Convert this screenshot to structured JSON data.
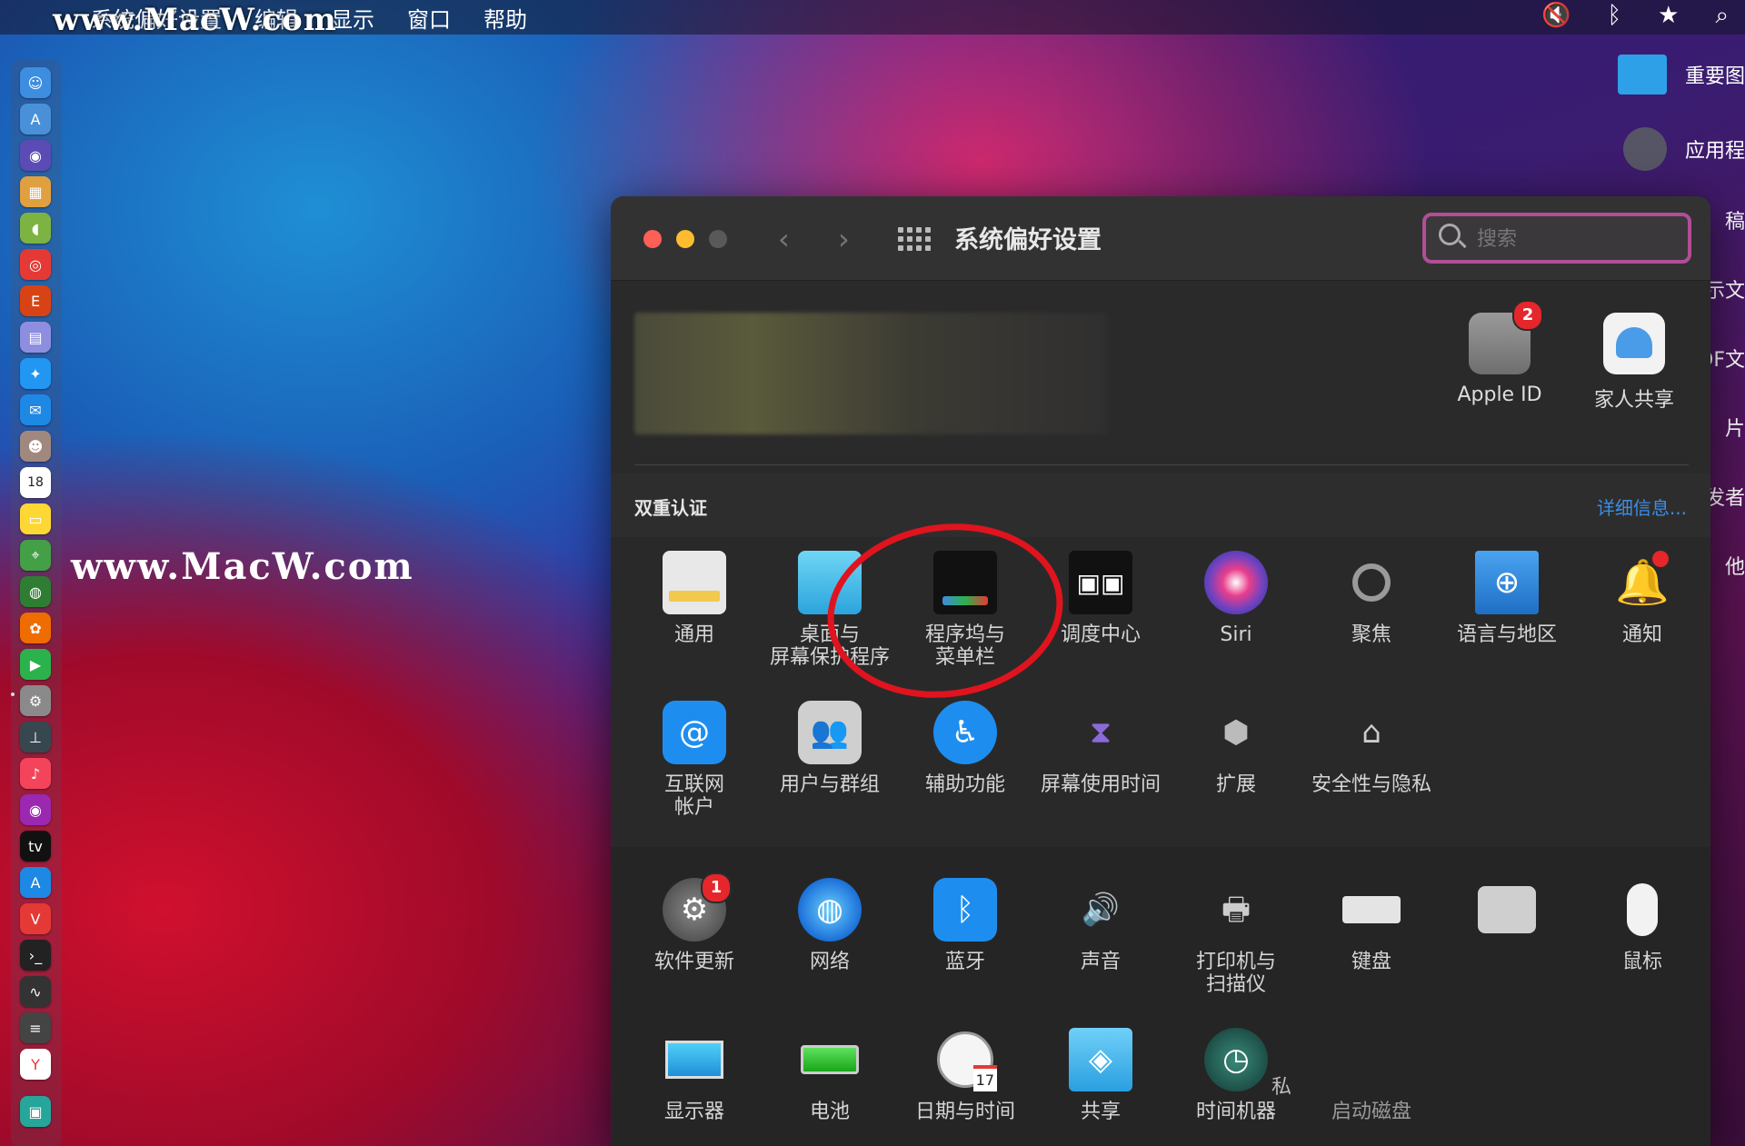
{
  "menubar": {
    "apple": "",
    "menus": [
      "系统偏好设置",
      "编辑",
      "显示",
      "窗口",
      "帮助"
    ],
    "status_icons": [
      "mute-icon",
      "bluetooth-icon",
      "star-icon",
      "search-icon"
    ]
  },
  "watermark": {
    "top": "www.MacW.com",
    "middle": "www.MacW.com"
  },
  "desktop": {
    "items": [
      {
        "label": "重要图",
        "icon": "folder-icon"
      },
      {
        "label": "应用程",
        "icon": "app-icon"
      }
    ],
    "edge_labels": [
      "稿",
      "示文",
      "DF文",
      "片",
      "发者",
      "他"
    ]
  },
  "window": {
    "title": "系统偏好设置",
    "search_placeholder": "搜索",
    "top_items": [
      {
        "label": "Apple ID",
        "badge": "2",
        "icon": "apple-id-icon"
      },
      {
        "label": "家人共享",
        "icon": "family-sharing-icon"
      }
    ],
    "two_factor": {
      "title": "双重认证",
      "link": "详细信息..."
    },
    "row1": [
      {
        "label": "通用",
        "icon": "general-icon"
      },
      {
        "label": "桌面与\n屏幕保护程序",
        "icon": "desktop-screensaver-icon"
      },
      {
        "label": "程序坞与\n菜单栏",
        "icon": "dock-menubar-icon"
      },
      {
        "label": "调度中心",
        "icon": "mission-control-icon"
      },
      {
        "label": "Siri",
        "icon": "siri-icon"
      },
      {
        "label": "聚焦",
        "icon": "spotlight-icon"
      },
      {
        "label": "语言与地区",
        "icon": "language-region-icon"
      },
      {
        "label": "通知",
        "icon": "notifications-icon"
      }
    ],
    "row2": [
      {
        "label": "互联网\n帐户",
        "icon": "internet-accounts-icon"
      },
      {
        "label": "用户与群组",
        "icon": "users-groups-icon"
      },
      {
        "label": "辅助功能",
        "icon": "accessibility-icon"
      },
      {
        "label": "屏幕使用时间",
        "icon": "screen-time-icon"
      },
      {
        "label": "扩展",
        "icon": "extensions-icon"
      },
      {
        "label": "安全性与隐私",
        "icon": "security-privacy-icon"
      }
    ],
    "row3": [
      {
        "label": "软件更新",
        "badge": "1",
        "icon": "software-update-icon"
      },
      {
        "label": "网络",
        "icon": "network-icon"
      },
      {
        "label": "蓝牙",
        "icon": "bluetooth-icon"
      },
      {
        "label": "声音",
        "icon": "sound-icon"
      },
      {
        "label": "打印机与\n扫描仪",
        "icon": "printers-scanners-icon"
      },
      {
        "label": "键盘",
        "icon": "keyboard-icon"
      },
      {
        "label": "",
        "icon": "trackpad-icon"
      },
      {
        "label": "鼠标",
        "icon": "mouse-icon"
      }
    ],
    "row4": [
      {
        "label": "显示器",
        "icon": "displays-icon"
      },
      {
        "label": "电池",
        "icon": "battery-icon"
      },
      {
        "label": "日期与时间",
        "icon": "date-time-icon"
      },
      {
        "label": "共享",
        "icon": "sharing-icon"
      },
      {
        "label": "时间机器",
        "icon": "time-machine-icon"
      },
      {
        "label": "启动磁盘",
        "icon": "startup-disk-icon"
      }
    ],
    "row4_fragment": "私",
    "date_badge": "17"
  },
  "colors": {
    "window_bg": "#2b2a2b",
    "accent_link": "#3a8fe6",
    "badge_red": "#e5262b",
    "highlight_ring": "#e0141e",
    "search_border": "#b14e96"
  }
}
